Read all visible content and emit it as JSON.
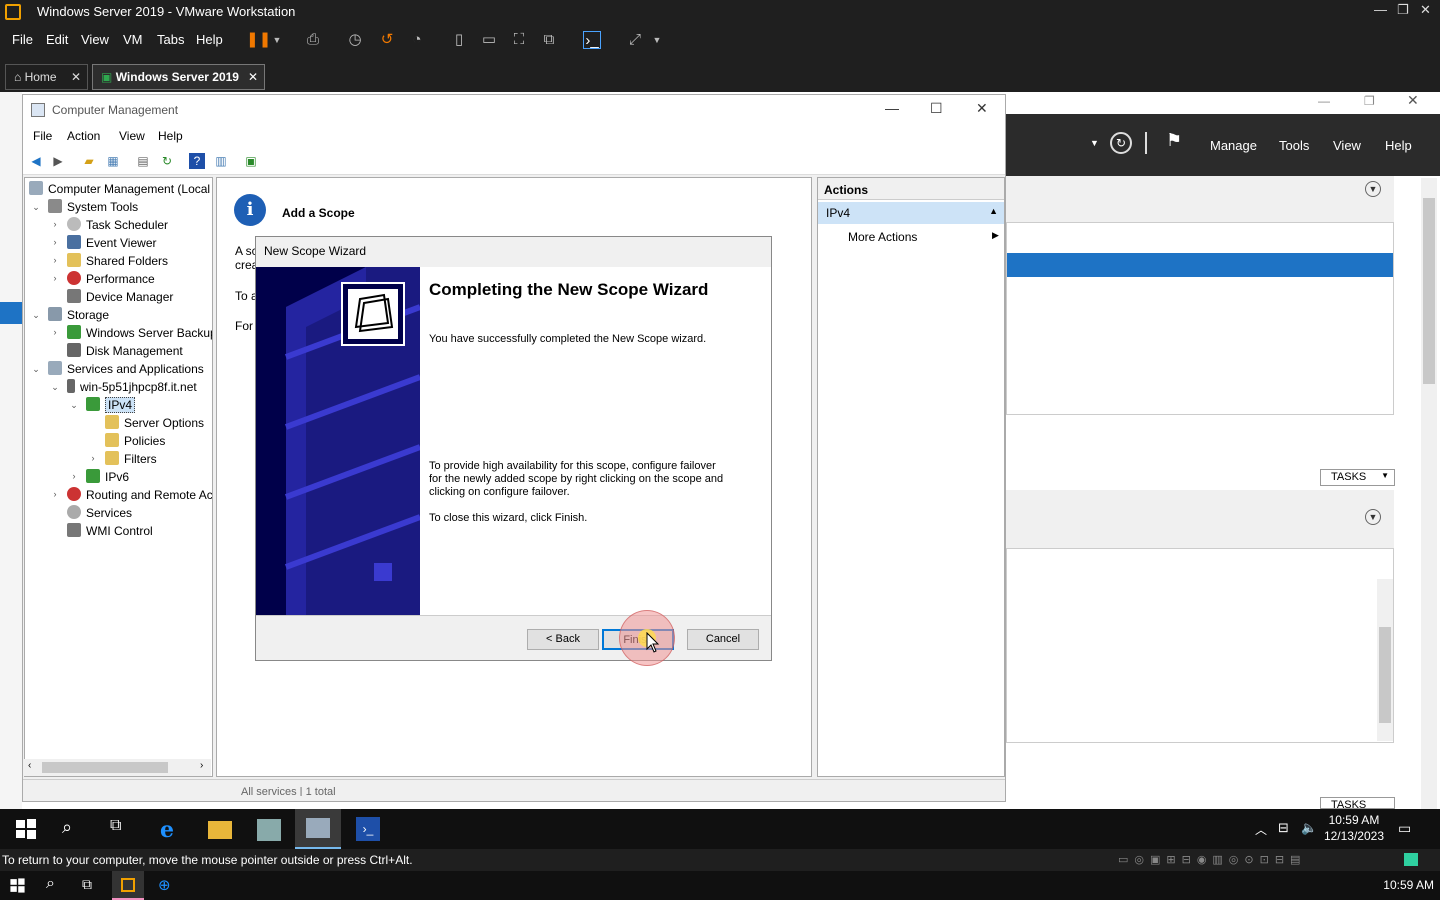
{
  "vmware": {
    "title": "Windows Server 2019 - VMware Workstation",
    "menu": [
      "File",
      "Edit",
      "View",
      "VM",
      "Tabs",
      "Help"
    ],
    "tabs": [
      {
        "label": "Home"
      },
      {
        "label": "Windows Server 2019"
      }
    ],
    "status_text": "To return to your computer, move the mouse pointer outside or press Ctrl+Alt.",
    "host_clock": "10:59 AM"
  },
  "server_manager": {
    "menu": [
      "Manage",
      "Tools",
      "View",
      "Help"
    ],
    "tasks_label": "TASKS",
    "footer_text": "All services | 1 total"
  },
  "computer_management": {
    "title": "Computer Management",
    "menu": [
      "File",
      "Action",
      "View",
      "Help"
    ],
    "tree": [
      {
        "label": "Computer Management (Local"
      },
      {
        "label": "System Tools"
      },
      {
        "label": "Task Scheduler"
      },
      {
        "label": "Event Viewer"
      },
      {
        "label": "Shared Folders"
      },
      {
        "label": "Performance"
      },
      {
        "label": "Device Manager"
      },
      {
        "label": "Storage"
      },
      {
        "label": "Windows Server Backup"
      },
      {
        "label": "Disk Management"
      },
      {
        "label": "Services and Applications"
      },
      {
        "label": "win-5p51jhpcp8f.it.net"
      },
      {
        "label": "IPv4"
      },
      {
        "label": "Server Options"
      },
      {
        "label": "Policies"
      },
      {
        "label": "Filters"
      },
      {
        "label": "IPv6"
      },
      {
        "label": "Routing and Remote Ac"
      },
      {
        "label": "Services"
      },
      {
        "label": "WMI Control"
      }
    ],
    "center": {
      "heading": "Add a Scope",
      "line1a": "A sc",
      "line1b": "crea",
      "line2": "To a",
      "line3": "For"
    },
    "actions": {
      "header": "Actions",
      "section": "IPv4",
      "more": "More Actions"
    }
  },
  "wizard": {
    "title": "New Scope Wizard",
    "heading": "Completing the New Scope Wizard",
    "para1": "You have successfully completed the New Scope wizard.",
    "para2": "To provide high availability for this scope, configure failover for the newly added scope by right clicking on the scope and clicking on configure failover.",
    "para3": "To close this wizard, click Finish.",
    "back": "< Back",
    "finish": "Finish",
    "cancel": "Cancel"
  },
  "guest_clock": {
    "time": "10:59 AM",
    "date": "12/13/2023"
  },
  "colors": {
    "accent": "#0078d7",
    "selection": "#cde3f7",
    "banner": "#00004a",
    "vmware_orange": "#f0a000"
  }
}
